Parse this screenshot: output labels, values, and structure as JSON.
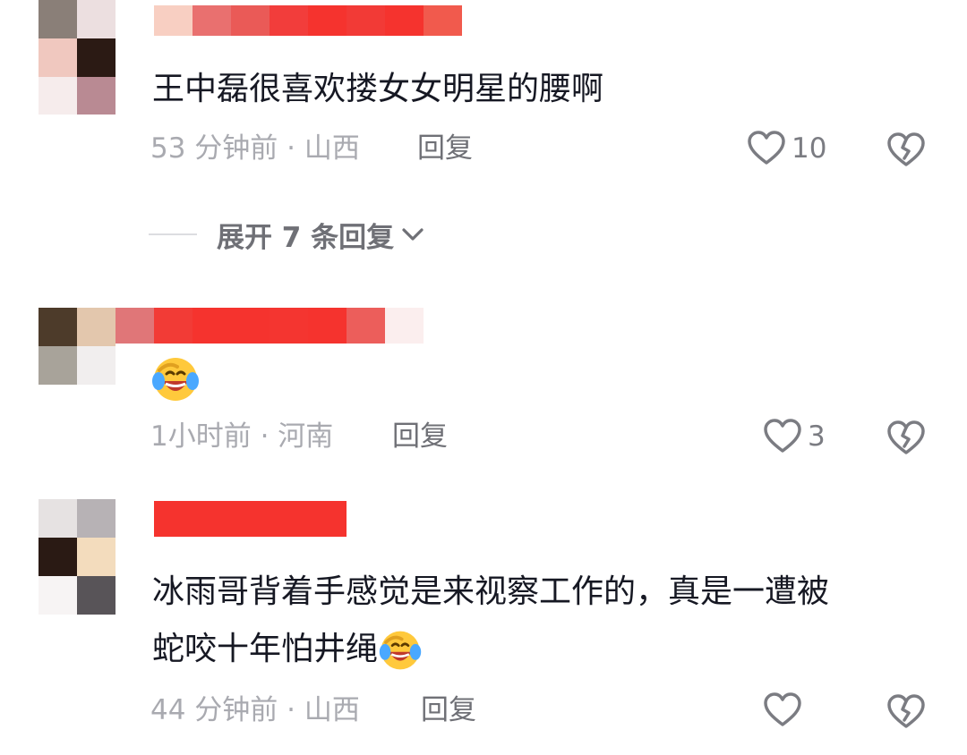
{
  "colors": {
    "text_primary": "#161823",
    "text_meta": "#a9aab0",
    "text_action": "#6f7076",
    "redaction_red": "#f5332e",
    "background": "#ffffff"
  },
  "comments": [
    {
      "text_lines": [
        "王中磊很喜欢搂女女明星的腰啊"
      ],
      "time_location": "53 分钟前 · 山西",
      "reply_label": "回复",
      "like_count": "10",
      "like_icon": "heart-outline-icon",
      "dislike_icon": "broken-heart-icon",
      "expand_replies_label": "展开 7 条回复"
    },
    {
      "text_lines": [
        ""
      ],
      "emoji": "laugh-cry-emoji",
      "time_location": "1小时前 · 河南",
      "reply_label": "回复",
      "like_count": "3",
      "like_icon": "heart-outline-icon",
      "dislike_icon": "broken-heart-icon"
    },
    {
      "text_lines": [
        "冰雨哥背着手感觉是来视察工作的，真是一遭被",
        "蛇咬十年怕井绳"
      ],
      "emoji": "laugh-cry-emoji",
      "time_location": "44 分钟前 · 山西",
      "reply_label": "回复",
      "like_icon": "heart-outline-icon",
      "dislike_icon": "broken-heart-icon"
    }
  ]
}
